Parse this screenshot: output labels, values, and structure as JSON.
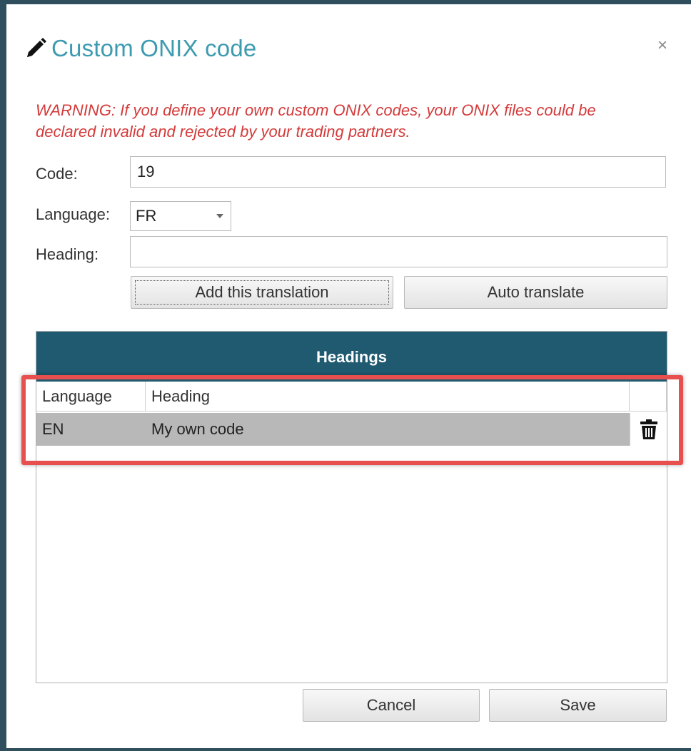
{
  "dialog": {
    "title": "Custom ONIX code",
    "close_label": "×",
    "warning": "WARNING: If you define your own custom ONIX codes, your ONIX files could be declared invalid and rejected by your trading partners."
  },
  "form": {
    "code_label": "Code:",
    "code_value": "19",
    "language_label": "Language:",
    "language_value": "FR",
    "heading_label": "Heading:",
    "heading_value": ""
  },
  "buttons": {
    "add_translation": "Add this translation",
    "auto_translate": "Auto translate",
    "cancel": "Cancel",
    "save": "Save"
  },
  "headings_table": {
    "title": "Headings",
    "columns": [
      "Language",
      "Heading"
    ],
    "rows": [
      {
        "language": "EN",
        "heading": "My own code"
      }
    ]
  },
  "icons": {
    "title_icon": "pencil-icon",
    "delete_icon": "trash-icon"
  },
  "colors": {
    "title": "#3d9bb0",
    "warning": "#d43a3a",
    "header_bar": "#1f5a70",
    "highlight": "#e85050"
  }
}
